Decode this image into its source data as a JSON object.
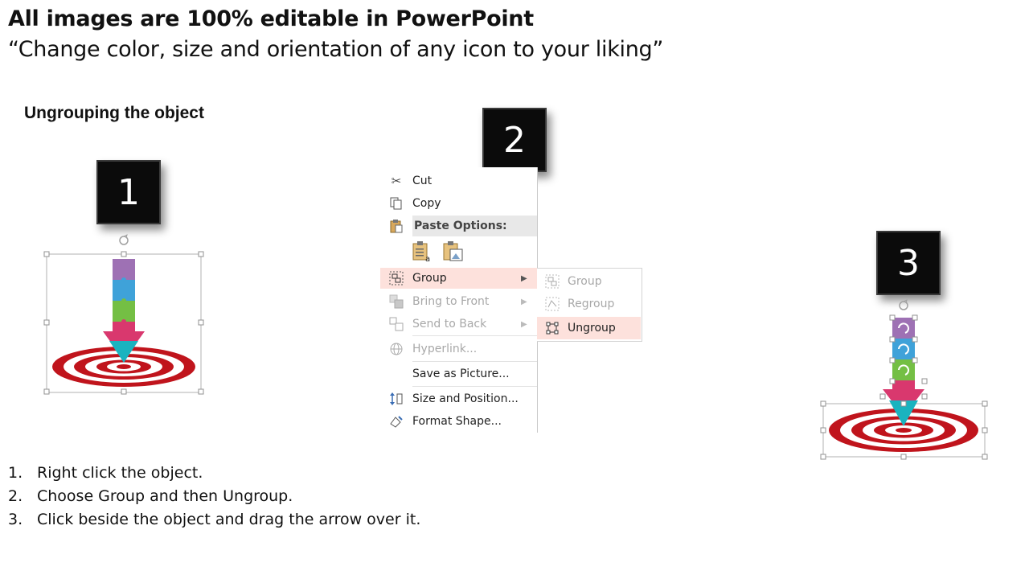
{
  "header": {
    "title": "All images are 100% editable in PowerPoint",
    "subtitle": "“Change color, size and orientation of any icon to your liking”"
  },
  "section_title": "Ungrouping the object",
  "step_boxes": [
    "1",
    "2",
    "3"
  ],
  "context_menu": {
    "items": [
      {
        "label": "Cut",
        "icon": "scissors-icon",
        "enabled": true
      },
      {
        "label": "Copy",
        "icon": "copy-icon",
        "enabled": true
      },
      {
        "label": "Paste Options:",
        "icon": "paste-icon",
        "enabled": true
      },
      {
        "label": "Group",
        "icon": "group-icon",
        "enabled": true,
        "highlighted": true,
        "submenu": true
      },
      {
        "label": "Bring to Front",
        "icon": "bring-to-front-icon",
        "enabled": false,
        "submenu": true
      },
      {
        "label": "Send to Back",
        "icon": "send-to-back-icon",
        "enabled": false,
        "submenu": true
      },
      {
        "label": "Hyperlink...",
        "icon": "hyperlink-icon",
        "enabled": false
      },
      {
        "label": "Save as Picture...",
        "enabled": true
      },
      {
        "label": "Size and Position...",
        "icon": "size-position-icon",
        "enabled": true
      },
      {
        "label": "Format Shape...",
        "icon": "format-shape-icon",
        "enabled": true
      }
    ],
    "submenu": [
      {
        "label": "Group",
        "icon": "group-icon",
        "enabled": false
      },
      {
        "label": "Regroup",
        "icon": "regroup-icon",
        "enabled": false
      },
      {
        "label": "Ungroup",
        "icon": "ungroup-icon",
        "enabled": true,
        "highlighted": true
      }
    ]
  },
  "instructions": [
    {
      "num": "1.",
      "text": "Right click the object."
    },
    {
      "num": "2.",
      "text": "Choose Group and then Ungroup."
    },
    {
      "num": "3.",
      "text": "Click beside the object and drag the arrow over it."
    }
  ],
  "colors": {
    "target_red": "#c0141c",
    "puzzle_purple": "#9e71b4",
    "puzzle_blue": "#3fa2d9",
    "puzzle_green": "#74bf44",
    "puzzle_pink": "#d9386e",
    "arrow_teal": "#1ab3bf",
    "menu_highlight": "#fde1dc"
  }
}
